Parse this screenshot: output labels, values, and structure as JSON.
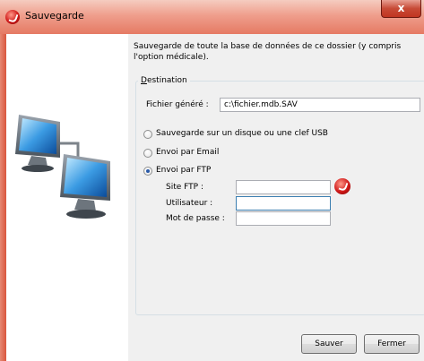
{
  "window": {
    "title": "Sauvegarde",
    "close_glyph": "x"
  },
  "description": "Sauvegarde de toute la base de données de ce dossier (y compris l'option médicale).",
  "destination": {
    "group_label_underlined": "D",
    "group_label_rest": "estination",
    "generated_file_label": "Fichier généré :",
    "generated_file_value": "c:\\fichier.mdb.SAV"
  },
  "options": [
    {
      "label": "Sauvegarde sur un disque ou une clef USB",
      "checked": false
    },
    {
      "label": "Envoi par Email",
      "checked": false
    },
    {
      "label": "Envoi par FTP",
      "checked": true
    }
  ],
  "ftp": {
    "site_label": "Site FTP :",
    "site_value": "",
    "user_label": "Utilisateur :",
    "user_value": "",
    "password_label": "Mot de passe :",
    "password_value": ""
  },
  "buttons": {
    "save": "Sauver",
    "close": "Fermer"
  },
  "icons": {
    "app": "backup-icon",
    "ftp": "ftp-check-icon",
    "illustration": "networked-computers-icon"
  },
  "colors": {
    "titlebar": "#ef9e8c",
    "accent_red": "#d01818",
    "selected_input_border": "#3c7fb1"
  }
}
